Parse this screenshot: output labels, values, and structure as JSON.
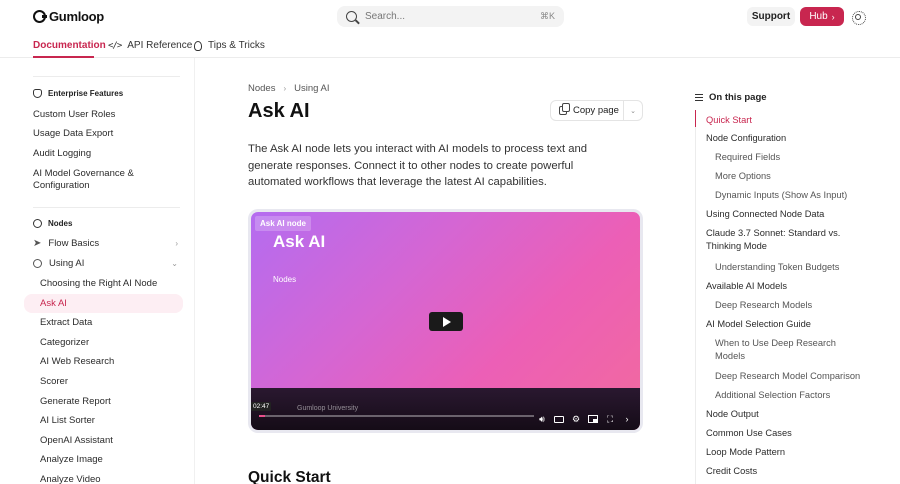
{
  "header": {
    "logo_text": "Gumloop",
    "search_placeholder": "Search...",
    "search_shortcut": "⌘K",
    "support_label": "Support",
    "hub_label": "Hub",
    "hub_chevron": "›"
  },
  "tabs": [
    {
      "label": "Documentation"
    },
    {
      "label": "API Reference"
    },
    {
      "label": "Tips & Tricks"
    }
  ],
  "sidebar": {
    "enterprise": {
      "heading": "Enterprise Features",
      "items": [
        "Custom User Roles",
        "Usage Data Export",
        "Audit Logging",
        "AI Model Governance & Configuration"
      ]
    },
    "nodes": {
      "heading": "Nodes",
      "flow_basics": "Flow Basics",
      "using_ai": "Using AI",
      "children": [
        "Choosing the Right AI Node",
        "Ask AI",
        "Extract Data",
        "Categorizer",
        "AI Web Research",
        "Scorer",
        "Generate Report",
        "AI List Sorter",
        "OpenAI Assistant",
        "Analyze Image",
        "Analyze Video"
      ]
    }
  },
  "main": {
    "breadcrumb": [
      "Nodes",
      "Using AI"
    ],
    "title": "Ask AI",
    "copy_label": "Copy page",
    "intro": "The Ask AI node lets you interact with AI models to process text and generate responses. Connect it to other nodes to create powerful automated workflows that leverage the latest AI capabilities.",
    "video": {
      "tag": "Ask AI node",
      "title": "Ask AI",
      "subtitle": "Nodes",
      "time": "02:47",
      "brand": "Gumloop University",
      "progress": 0.02
    },
    "section_title": "Quick Start"
  },
  "toc": {
    "heading": "On this page",
    "items": [
      {
        "label": "Quick Start",
        "level": 1,
        "active": true
      },
      {
        "label": "Node Configuration",
        "level": 1
      },
      {
        "label": "Required Fields",
        "level": 2
      },
      {
        "label": "More Options",
        "level": 2
      },
      {
        "label": "Dynamic Inputs (Show As Input)",
        "level": 2
      },
      {
        "label": "Using Connected Node Data",
        "level": 1
      },
      {
        "label": "Claude 3.7 Sonnet: Standard vs. Thinking Mode",
        "level": 1
      },
      {
        "label": "Understanding Token Budgets",
        "level": 2
      },
      {
        "label": "Available AI Models",
        "level": 1
      },
      {
        "label": "Deep Research Models",
        "level": 2
      },
      {
        "label": "AI Model Selection Guide",
        "level": 1
      },
      {
        "label": "When to Use Deep Research Models",
        "level": 2
      },
      {
        "label": "Deep Research Model Comparison",
        "level": 2
      },
      {
        "label": "Additional Selection Factors",
        "level": 2
      },
      {
        "label": "Node Output",
        "level": 1
      },
      {
        "label": "Common Use Cases",
        "level": 1
      },
      {
        "label": "Loop Mode Pattern",
        "level": 1
      },
      {
        "label": "Credit Costs",
        "level": 1
      }
    ]
  },
  "colors": {
    "accent": "#c8264f",
    "active_bg": "#fdeef3"
  }
}
